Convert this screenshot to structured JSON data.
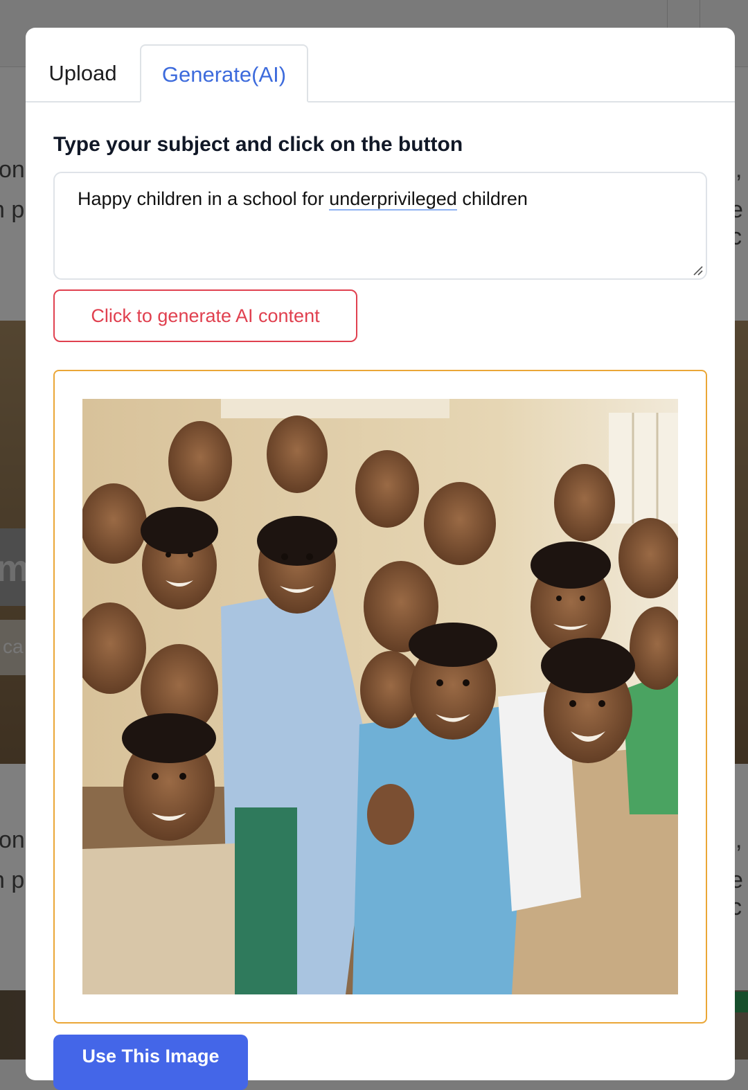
{
  "background": {
    "fragments": [
      "on",
      "n p",
      "on",
      "n p",
      ",",
      "e c",
      ",",
      "e c"
    ],
    "big_fragment": "m",
    "small_fragment": "ca"
  },
  "modal": {
    "tabs": [
      {
        "label": "Upload",
        "active": false
      },
      {
        "label": "Generate(AI)",
        "active": true
      }
    ],
    "prompt_label": "Type your subject and click on the button",
    "subject": {
      "before": "Happy children in a school for ",
      "misspelled": "underprivileged",
      "after": " children"
    },
    "generate_button": "Click to generate AI content",
    "use_button": "Use This Image"
  },
  "colors": {
    "active_tab": "#3d6bdc",
    "generate_button": "#e0404f",
    "image_frame": "#eaa636",
    "use_button": "#4466e8"
  }
}
